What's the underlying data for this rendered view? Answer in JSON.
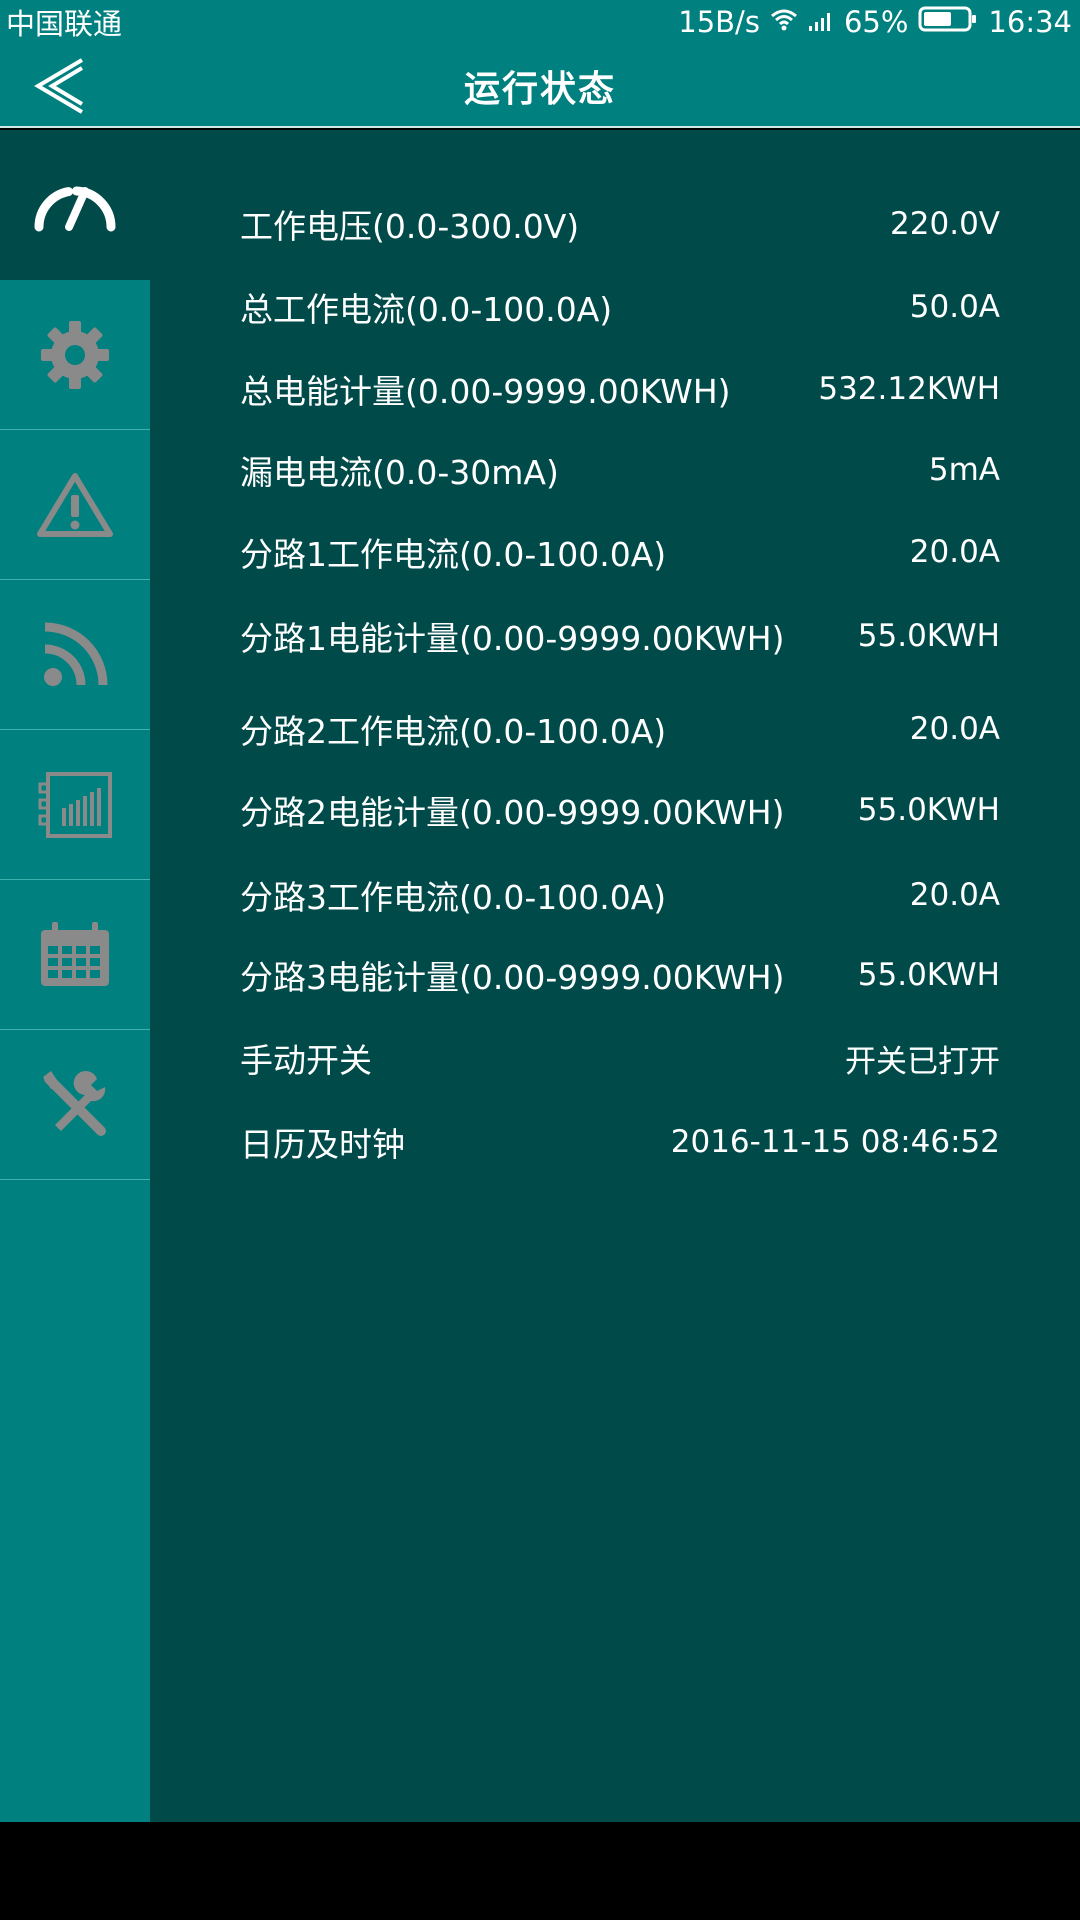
{
  "status_bar": {
    "carrier": "中国联通",
    "speed": "15B/s",
    "battery_percent": "65%",
    "battery_level": 0.65,
    "time": "16:34",
    "icons": [
      "wifi-icon",
      "signal-icon",
      "battery-icon"
    ]
  },
  "header": {
    "title": "运行状态",
    "back_icon": "chevron-left-icon"
  },
  "sidebar": {
    "items": [
      {
        "icon": "gauge-icon",
        "active": true
      },
      {
        "icon": "gear-icon",
        "active": false
      },
      {
        "icon": "warning-icon",
        "active": false
      },
      {
        "icon": "rss-icon",
        "active": false
      },
      {
        "icon": "meter-icon",
        "active": false
      },
      {
        "icon": "calendar-icon",
        "active": false
      },
      {
        "icon": "tools-icon",
        "active": false
      }
    ]
  },
  "rows": [
    {
      "label": "工作电压(0.0-300.0V)",
      "value": "220.0V"
    },
    {
      "label": "总工作电流(0.0-100.0A)",
      "value": "50.0A"
    },
    {
      "label": "总电能计量(0.00-9999.00KWH)",
      "value": "532.12KWH"
    },
    {
      "label": "漏电电流(0.0-30mA)",
      "value": "5mA"
    },
    {
      "label": "分路1工作电流(0.0-100.0A)",
      "value": "20.0A"
    },
    {
      "label": "分路1电能计量(0.00-9999.00KWH)",
      "value": "55.0KWH"
    },
    {
      "label": "分路2工作电流(0.0-100.0A)",
      "value": "20.0A"
    },
    {
      "label": "分路2电能计量(0.00-9999.00KWH)",
      "value": "55.0KWH"
    },
    {
      "label": "分路3工作电流(0.0-100.0A)",
      "value": "20.0A"
    },
    {
      "label": "分路3电能计量(0.00-9999.00KWH)",
      "value": "55.0KWH"
    },
    {
      "label": "手动开关",
      "value": "开关已打开"
    },
    {
      "label": "日历及时钟",
      "value": "2016-11-15 08:46:52"
    }
  ],
  "colors": {
    "header_bg": "#00807f",
    "content_bg": "#004a4a",
    "icon_gray": "#8a8a8a",
    "text": "#ffffff"
  }
}
